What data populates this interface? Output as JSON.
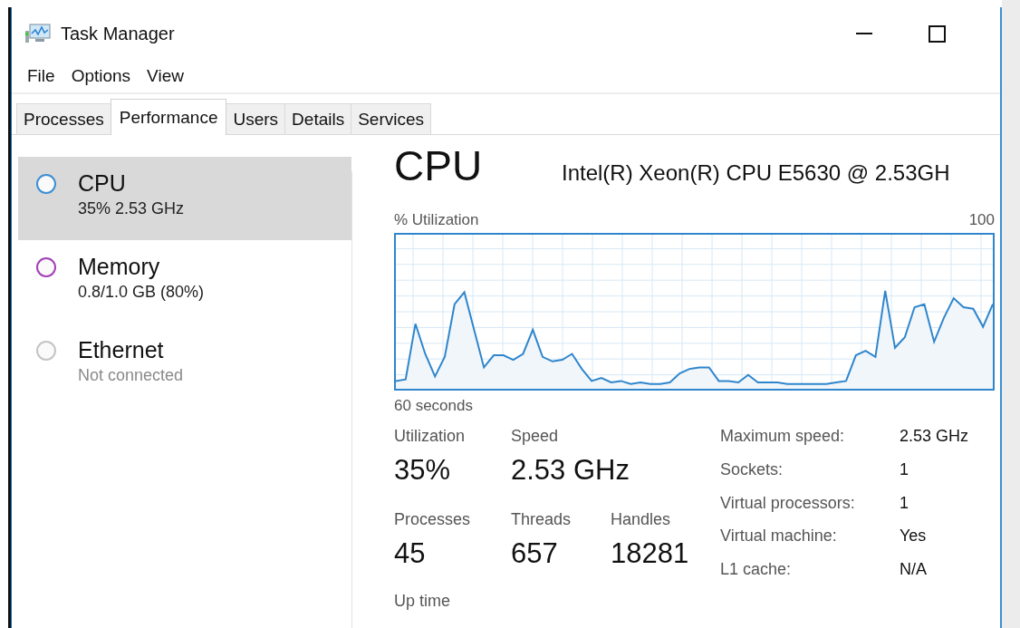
{
  "window": {
    "title": "Task Manager"
  },
  "menu": [
    "File",
    "Options",
    "View"
  ],
  "tabs": [
    {
      "label": "Processes",
      "selected": false
    },
    {
      "label": "Performance",
      "selected": true
    },
    {
      "label": "Users",
      "selected": false
    },
    {
      "label": "Details",
      "selected": false
    },
    {
      "label": "Services",
      "selected": false
    }
  ],
  "sidebar": {
    "items": [
      {
        "name": "CPU",
        "detail": "35% 2.53 GHz",
        "color": "#3d8fd6",
        "selected": true,
        "inactive": false
      },
      {
        "name": "Memory",
        "detail": "0.8/1.0 GB (80%)",
        "color": "#a43fb8",
        "selected": false,
        "inactive": false
      },
      {
        "name": "Ethernet",
        "detail": "Not connected",
        "color": "#c4c4c4",
        "selected": false,
        "inactive": true
      }
    ]
  },
  "panel": {
    "title": "CPU",
    "model": "Intel(R) Xeon(R) CPU E5630 @ 2.53GH",
    "graph_label": "% Utilization",
    "graph_max": "100",
    "graph_span": "60 seconds",
    "stats": [
      {
        "label": "Utilization",
        "value": "35%"
      },
      {
        "label": "Speed",
        "value": "2.53 GHz"
      },
      {
        "label": "Processes",
        "value": "45"
      },
      {
        "label": "Threads",
        "value": "657"
      },
      {
        "label": "Handles",
        "value": "18281"
      }
    ],
    "details": [
      {
        "label": "Maximum speed:",
        "value": "2.53 GHz"
      },
      {
        "label": "Sockets:",
        "value": "1"
      },
      {
        "label": "Virtual processors:",
        "value": "1"
      },
      {
        "label": "Virtual machine:",
        "value": "Yes"
      },
      {
        "label": "L1 cache:",
        "value": "N/A"
      }
    ],
    "uptime_label": "Up time"
  }
}
